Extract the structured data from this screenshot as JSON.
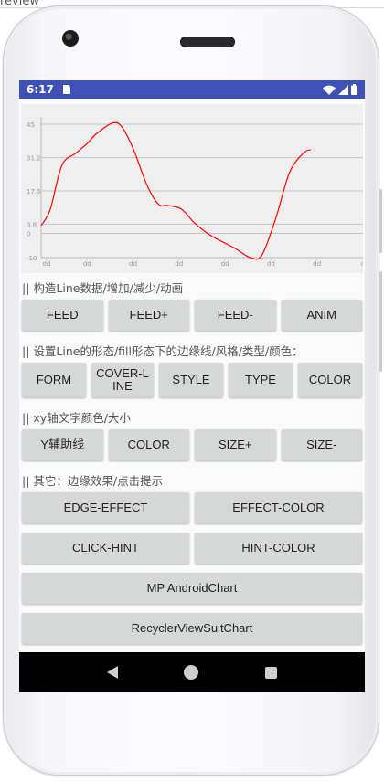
{
  "window": {
    "title_fragment": "review"
  },
  "statusbar": {
    "time": "6:17"
  },
  "chart_data": {
    "type": "line",
    "x": [
      "dd",
      "dd",
      "dd",
      "dd",
      "dd",
      "dd",
      "dd",
      "d"
    ],
    "yticks": [
      "45",
      "31.2",
      "17.5",
      "3.8",
      "0",
      "-10"
    ],
    "ylim": [
      -10,
      45
    ],
    "series": [
      {
        "color": "#ff0000",
        "points": [
          [
            0,
            3.2
          ],
          [
            0.2,
            10
          ],
          [
            0.45,
            28
          ],
          [
            0.75,
            33
          ],
          [
            1.0,
            37
          ],
          [
            1.2,
            41
          ],
          [
            1.55,
            45.5
          ],
          [
            1.75,
            44
          ],
          [
            2.0,
            35
          ],
          [
            2.3,
            20
          ],
          [
            2.55,
            12
          ],
          [
            2.75,
            11.5
          ],
          [
            3.05,
            10
          ],
          [
            3.35,
            4
          ],
          [
            3.7,
            -1
          ],
          [
            4.2,
            -6
          ],
          [
            4.55,
            -10
          ],
          [
            4.8,
            -9
          ],
          [
            5.1,
            6
          ],
          [
            5.4,
            25
          ],
          [
            5.7,
            33
          ],
          [
            5.86,
            34.5
          ]
        ]
      }
    ],
    "grid": "horizontal"
  },
  "sections": {
    "line_data": "|| 构造Line数据/增加/减少/动画",
    "line_style": "|| 设置Line的形态/fill形态下的边缘线/风格/类型/颜色：",
    "axis_text": "|| xy轴文字颜色/大小",
    "other": "|| 其它：边缘效果/点击提示"
  },
  "buttons": {
    "feed": "FEED",
    "feed_plus": "FEED+",
    "feed_minus": "FEED-",
    "anim": "ANIM",
    "form": "FORM",
    "cover_line": "COVER-LINE",
    "style": "STYLE",
    "type": "TYPE",
    "color": "COLOR",
    "y_guide": "Y辅助线",
    "axis_color": "COLOR",
    "size_plus": "SIZE+",
    "size_minus": "SIZE-",
    "edge_effect": "EDGE-EFFECT",
    "effect_color": "EFFECT-COLOR",
    "click_hint": "CLICK-HINT",
    "hint_color": "HINT-COLOR",
    "mp_androidchart": "MP AndroidChart",
    "recyclerview_suit_chart": "RecyclerViewSuitChart"
  },
  "navbar": {
    "icons": [
      "back-icon",
      "home-icon",
      "recents-icon"
    ]
  }
}
